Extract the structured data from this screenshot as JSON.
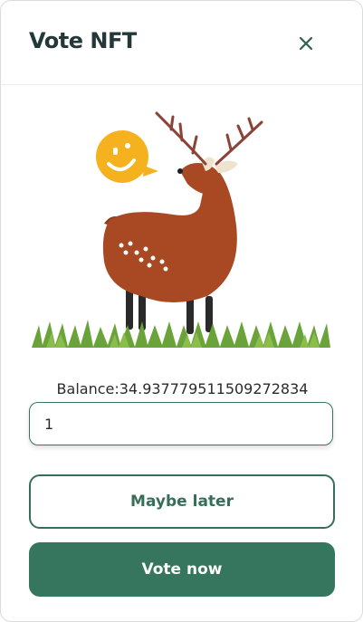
{
  "modal": {
    "title": "Vote NFT",
    "balance_label": "Balance:34.937779511509272834",
    "amount_input": {
      "value": "1",
      "placeholder": ""
    },
    "maybe_later_label": "Maybe later",
    "vote_now_label": "Vote now"
  },
  "colors": {
    "primary": "#36765e",
    "title": "#24383a",
    "deer_body": "#a94924",
    "emoji": "#f5b21e",
    "grass": "#6aa33a"
  },
  "icons": {
    "close": "close-icon",
    "illustration": "deer-illustration",
    "emoji": "smiley-bubble-icon"
  }
}
